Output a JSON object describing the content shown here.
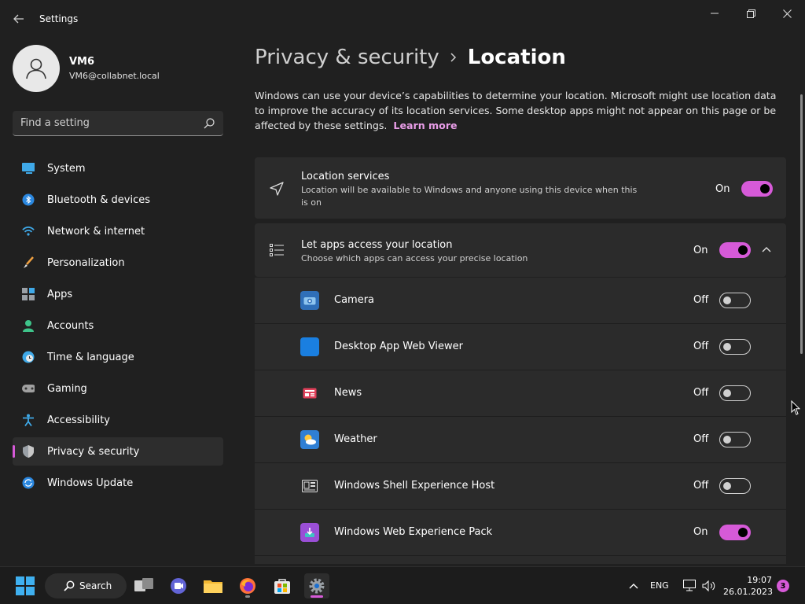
{
  "window": {
    "title": "Settings",
    "back_icon": "arrow-left-icon",
    "minimize_icon": "minimize-icon",
    "maximize_icon": "restore-icon",
    "close_icon": "close-icon"
  },
  "profile": {
    "name": "VM6",
    "email": "VM6@collabnet.local"
  },
  "search": {
    "placeholder": "Find a setting"
  },
  "sidebar": {
    "items": [
      {
        "label": "System",
        "icon": "monitor-icon",
        "active": false
      },
      {
        "label": "Bluetooth & devices",
        "icon": "bluetooth-icon",
        "active": false
      },
      {
        "label": "Network & internet",
        "icon": "wifi-icon",
        "active": false
      },
      {
        "label": "Personalization",
        "icon": "brush-icon",
        "active": false
      },
      {
        "label": "Apps",
        "icon": "apps-icon",
        "active": false
      },
      {
        "label": "Accounts",
        "icon": "person-icon",
        "active": false
      },
      {
        "label": "Time & language",
        "icon": "clock-globe-icon",
        "active": false
      },
      {
        "label": "Gaming",
        "icon": "gamepad-icon",
        "active": false
      },
      {
        "label": "Accessibility",
        "icon": "accessibility-icon",
        "active": false
      },
      {
        "label": "Privacy & security",
        "icon": "shield-icon",
        "active": true
      },
      {
        "label": "Windows Update",
        "icon": "update-icon",
        "active": false
      }
    ]
  },
  "main": {
    "breadcrumb_parent": "Privacy & security",
    "breadcrumb_current": "Location",
    "description": "Windows can use your device’s capabilities to determine your location. Microsoft might use location data to improve the accuracy of its location services. Some desktop apps might not appear on this page or be affected by these settings.",
    "learn_more": "Learn more",
    "location_services": {
      "title": "Location services",
      "subtitle_line1": "Location will be available to Windows and anyone using this device when this",
      "subtitle_line2": "is on",
      "state": "On"
    },
    "apps_access": {
      "title": "Let apps access your location",
      "subtitle": "Choose which apps can access your precise location",
      "state": "On"
    },
    "apps": [
      {
        "name": "Camera",
        "state": "Off",
        "icon": "camera-app-icon"
      },
      {
        "name": "Desktop App Web Viewer",
        "state": "Off",
        "icon": "web-viewer-app-icon"
      },
      {
        "name": "News",
        "state": "Off",
        "icon": "news-app-icon"
      },
      {
        "name": "Weather",
        "state": "Off",
        "icon": "weather-app-icon"
      },
      {
        "name": "Windows Shell Experience Host",
        "state": "Off",
        "icon": "shell-host-app-icon"
      },
      {
        "name": "Windows Web Experience Pack",
        "state": "On",
        "icon": "web-experience-app-icon"
      }
    ]
  },
  "taskbar": {
    "search_label": "Search",
    "language": "ENG",
    "time": "19:07",
    "date": "26.01.2023",
    "notifications": "3"
  },
  "colors": {
    "accent": "#d65ad8",
    "background": "#202020",
    "card": "#2b2b2b"
  }
}
